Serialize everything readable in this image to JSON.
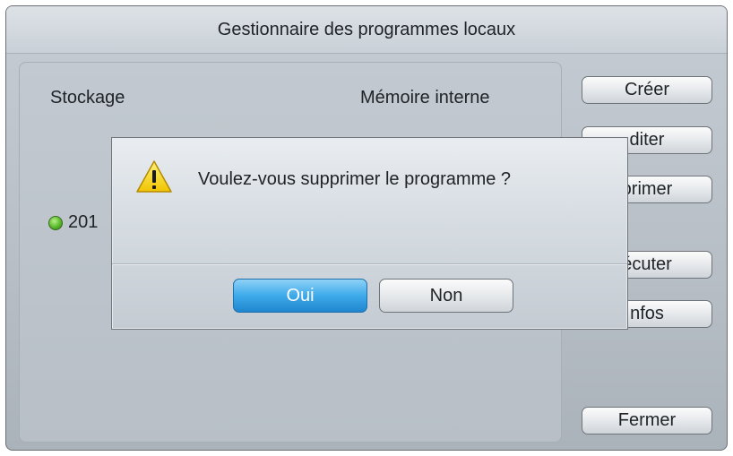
{
  "window": {
    "title": "Gestionnaire des programmes locaux"
  },
  "panel": {
    "storage_label": "Stockage",
    "storage_value": "Mémoire interne",
    "items": [
      {
        "label": "201",
        "status_color": "#58b92a"
      }
    ]
  },
  "side_buttons": {
    "create": "Créer",
    "edit": "diter",
    "delete": "primer",
    "execute": "écuter",
    "info": "nfos",
    "close": "Fermer"
  },
  "dialog": {
    "icon": "warning-icon",
    "message": "Voulez-vous supprimer le programme ?",
    "yes_label": "Oui",
    "no_label": "Non"
  },
  "colors": {
    "accent": "#3eaaea",
    "warning": "#f5d21a"
  }
}
